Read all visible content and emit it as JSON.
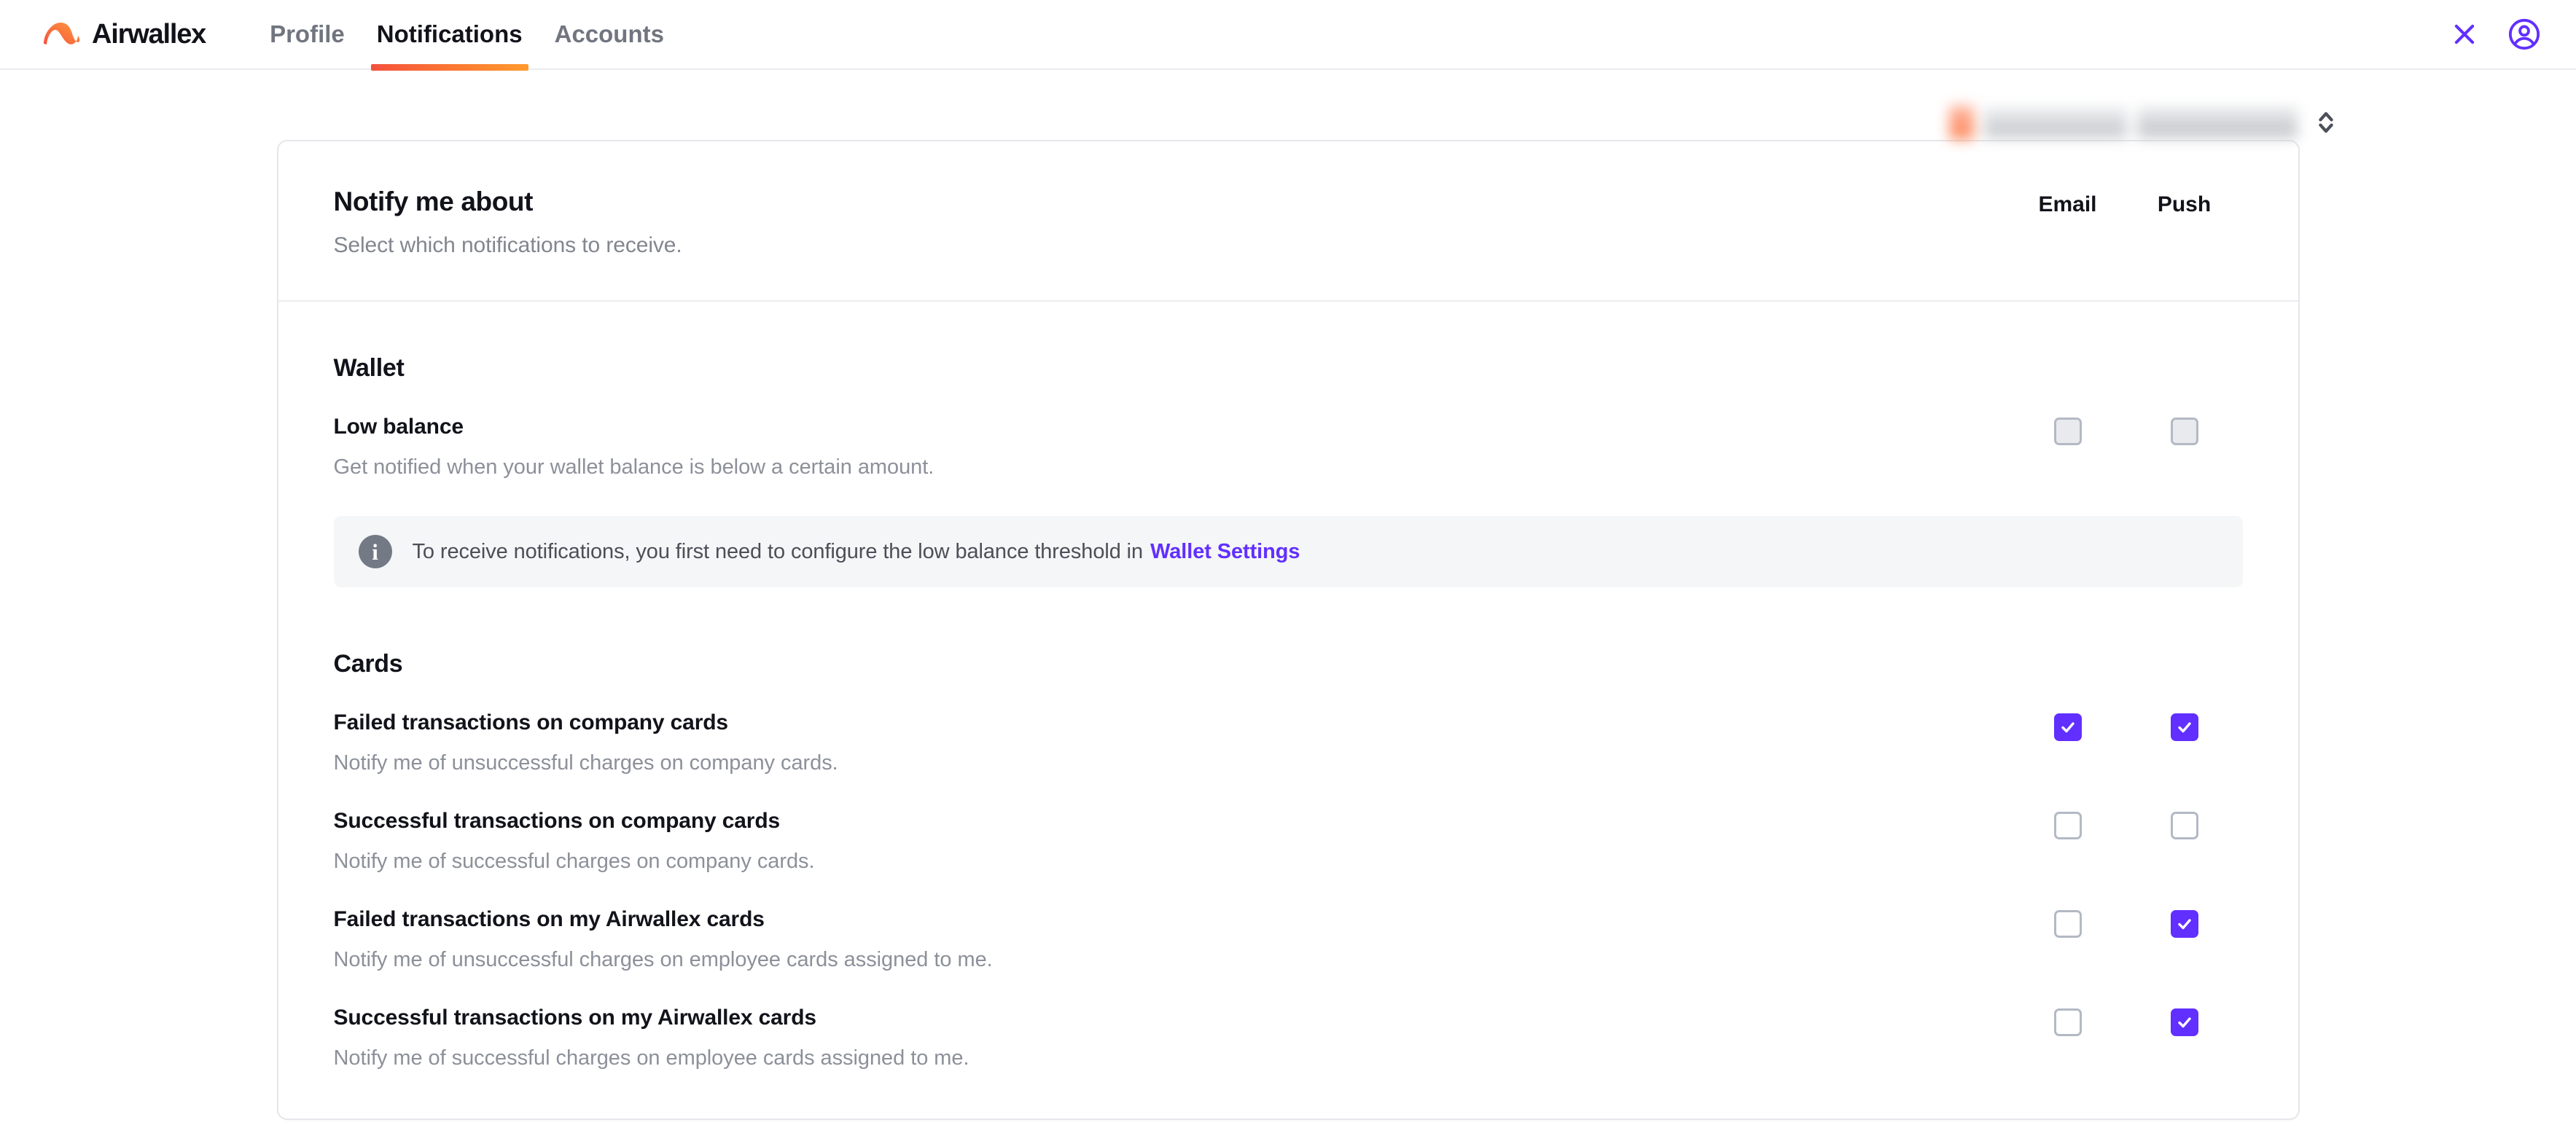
{
  "app": {
    "brand_name": "Airwallex",
    "brand_mark_icon": "airwallex-logo-icon",
    "accent_purple": "#612fff",
    "accent_orange_start": "#f4513d",
    "accent_orange_end": "#ff9a2e"
  },
  "nav": {
    "tabs": [
      {
        "label": "Profile",
        "active": false
      },
      {
        "label": "Notifications",
        "active": true
      },
      {
        "label": "Accounts",
        "active": false
      }
    ],
    "close_icon": "close-icon",
    "account_icon": "user-circle-icon"
  },
  "account_selector": {
    "redacted": true,
    "chevron_icon": "chevron-up-down-icon"
  },
  "card": {
    "title": "Notify me about",
    "subtitle": "Select which notifications to receive.",
    "columns": [
      "Email",
      "Push"
    ]
  },
  "sections": [
    {
      "title": "Wallet",
      "rows": [
        {
          "label": "Low balance",
          "description": "Get notified when your wallet balance is below a certain amount.",
          "email": {
            "checked": false,
            "disabled": true
          },
          "push": {
            "checked": false,
            "disabled": true
          }
        }
      ],
      "banner": {
        "icon": "info-icon",
        "text": "To receive notifications, you first need to configure the low balance threshold in",
        "link_label": "Wallet Settings"
      }
    },
    {
      "title": "Cards",
      "rows": [
        {
          "label": "Failed transactions on company cards",
          "description": "Notify me of unsuccessful charges on company cards.",
          "email": {
            "checked": true,
            "disabled": false
          },
          "push": {
            "checked": true,
            "disabled": false
          }
        },
        {
          "label": "Successful transactions on company cards",
          "description": "Notify me of successful charges on company cards.",
          "email": {
            "checked": false,
            "disabled": false
          },
          "push": {
            "checked": false,
            "disabled": false
          }
        },
        {
          "label": "Failed transactions on my Airwallex cards",
          "description": "Notify me of unsuccessful charges on employee cards assigned to me.",
          "email": {
            "checked": false,
            "disabled": false
          },
          "push": {
            "checked": true,
            "disabled": false
          }
        },
        {
          "label": "Successful transactions on my Airwallex cards",
          "description": "Notify me of successful charges on employee cards assigned to me.",
          "email": {
            "checked": false,
            "disabled": false
          },
          "push": {
            "checked": true,
            "disabled": false
          }
        }
      ]
    }
  ]
}
